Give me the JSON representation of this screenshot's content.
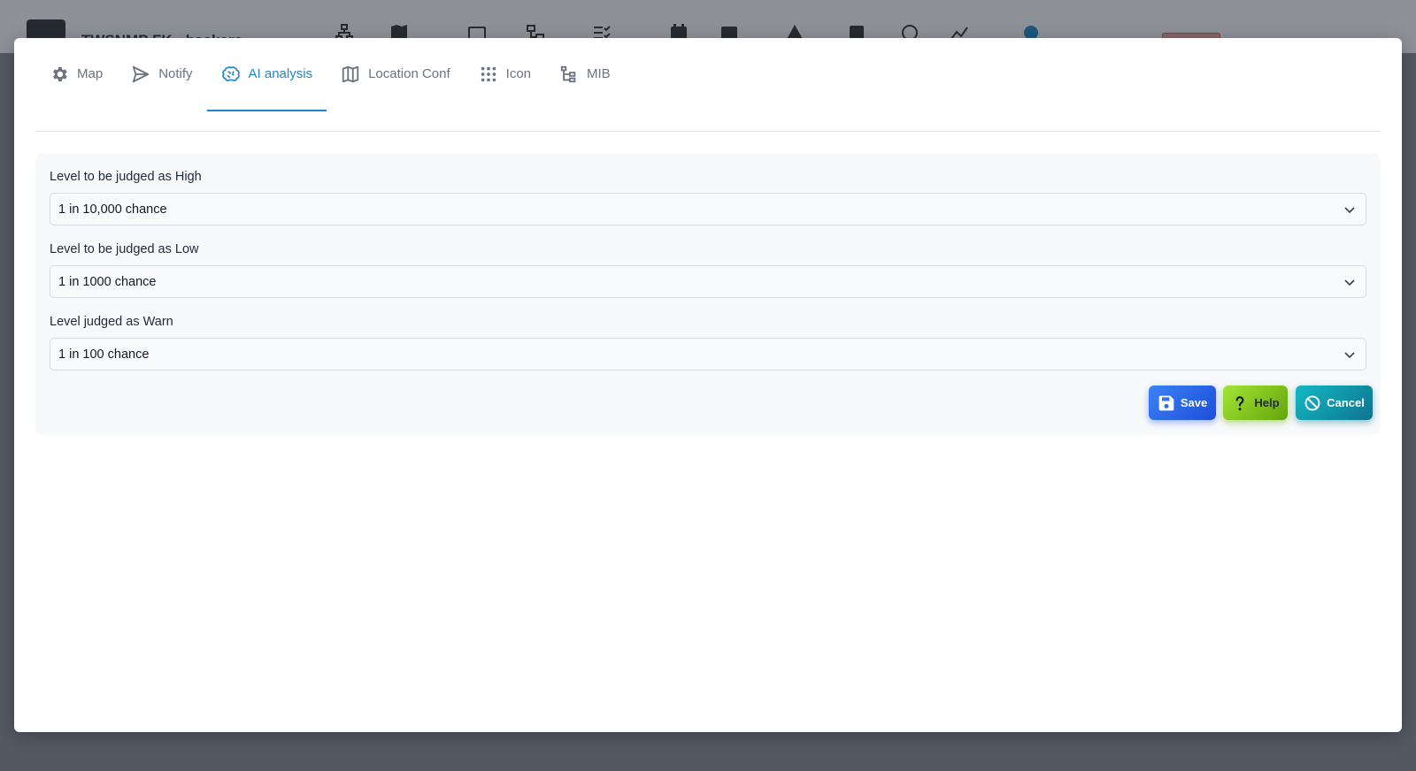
{
  "background": {
    "app_title": "TWSNMP FK - hackers",
    "toolbar_icons": [
      "network-icon",
      "map-icon",
      "window-icon",
      "devices-icon",
      "checklist-icon",
      "calendar-icon",
      "calendar-notes-icon",
      "warning-icon",
      "check-square-icon",
      "brain-icon",
      "chart-icon",
      "gear-icon"
    ]
  },
  "tabs": [
    {
      "label": "Map",
      "icon": "gear-icon",
      "active": false
    },
    {
      "label": "Notify",
      "icon": "send-icon",
      "active": false
    },
    {
      "label": "AI analysis",
      "icon": "brain-icon",
      "active": true
    },
    {
      "label": "Location Conf",
      "icon": "map-icon",
      "active": false
    },
    {
      "label": "Icon",
      "icon": "grid-dots-icon",
      "active": false
    },
    {
      "label": "MIB",
      "icon": "tree-icon",
      "active": false
    }
  ],
  "form": {
    "high": {
      "label": "Level to be judged as High",
      "value": "1 in 10,000 chance"
    },
    "low": {
      "label": "Level to be judged as Low",
      "value": "1 in 1000 chance"
    },
    "warn": {
      "label": "Level judged as Warn",
      "value": "1 in 100 chance"
    }
  },
  "buttons": {
    "save": "Save",
    "help": "Help",
    "cancel": "Cancel"
  },
  "colors": {
    "accent": "#1f87c8",
    "save": "#2563eb",
    "help": "#84cc16",
    "cancel": "#0e9aa8"
  }
}
